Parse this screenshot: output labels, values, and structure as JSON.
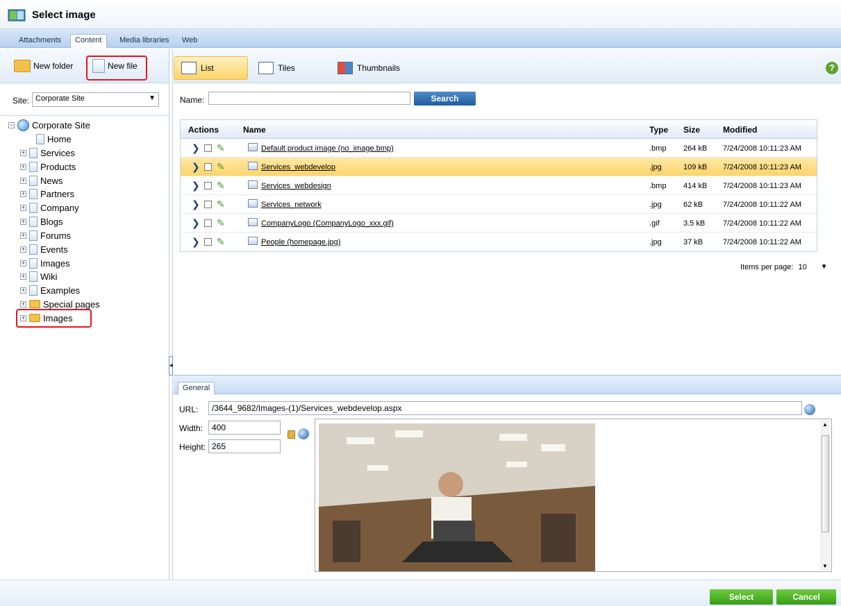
{
  "window": {
    "title": "Select image"
  },
  "tabs": [
    {
      "label": "Attachments",
      "active": false
    },
    {
      "label": "Content",
      "active": true
    },
    {
      "label": "Media libraries",
      "active": false
    },
    {
      "label": "Web",
      "active": false
    }
  ],
  "left_toolbar": {
    "new_folder_label": "New folder",
    "new_file_label": "New file"
  },
  "site": {
    "label": "Site:",
    "value": "Corporate Site"
  },
  "tree": {
    "root": "Corporate Site",
    "children": [
      "Home",
      "Services",
      "Products",
      "News",
      "Partners",
      "Company",
      "Blogs",
      "Forums",
      "Events",
      "Images",
      "Wiki",
      "Examples",
      "Special pages"
    ],
    "extra": "Images"
  },
  "views": {
    "list": "List",
    "tiles": "Tiles",
    "thumbnails": "Thumbnails"
  },
  "search": {
    "name_label": "Name:",
    "button": "Search"
  },
  "table": {
    "headers": {
      "actions": "Actions",
      "name": "Name",
      "type": "Type",
      "size": "Size",
      "modified": "Modified"
    },
    "rows": [
      {
        "name": "Default product image (no_image.bmp)",
        "type": ".bmp",
        "size": "264 kB",
        "modified": "7/24/2008 10:11:23 AM",
        "selected": false
      },
      {
        "name": "Services_webdevelop",
        "type": ".jpg",
        "size": "109 kB",
        "modified": "7/24/2008 10:11:23 AM",
        "selected": true
      },
      {
        "name": "Services_webdesign",
        "type": ".bmp",
        "size": "414 kB",
        "modified": "7/24/2008 10:11:23 AM",
        "selected": false
      },
      {
        "name": "Services_network",
        "type": ".jpg",
        "size": "62 kB",
        "modified": "7/24/2008 10:11:22 AM",
        "selected": false
      },
      {
        "name": "CompanyLogo (CompanyLogo_xxx.gif)",
        "type": ".gif",
        "size": "3.5 kB",
        "modified": "7/24/2008 10:11:22 AM",
        "selected": false
      },
      {
        "name": "People (homepage.jpg)",
        "type": ".jpg",
        "size": "37 kB",
        "modified": "7/24/2008 10:11:22 AM",
        "selected": false
      }
    ]
  },
  "pager": {
    "items_per_page_label": "Items per page:",
    "items_per_page_value": "10"
  },
  "general": {
    "tab_label": "General",
    "url_label": "URL:",
    "url_value": "/3644_9682/Images-(1)/Services_webdevelop.aspx",
    "width_label": "Width:",
    "width_value": "400",
    "height_label": "Height:",
    "height_value": "265"
  },
  "footer": {
    "select_label": "Select",
    "cancel_label": "Cancel"
  },
  "colors": {
    "accent": "#fcd468",
    "highlight": "#e4141f",
    "primary_button": "#1f5d9e",
    "action_button": "#399c1a"
  }
}
